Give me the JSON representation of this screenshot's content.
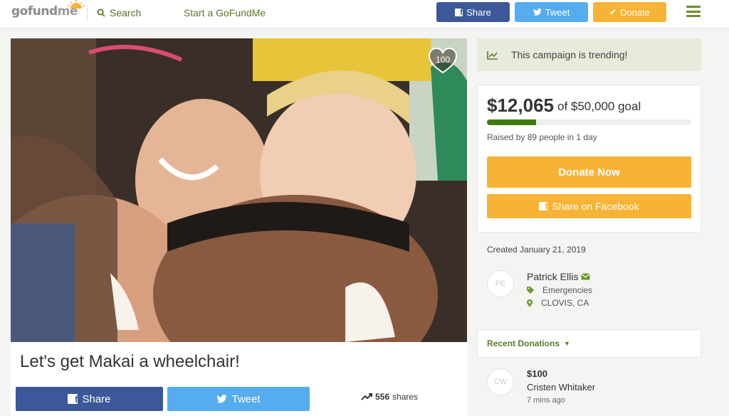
{
  "header": {
    "logo_go": "gofund",
    "logo_me": "me",
    "search_label": "Search",
    "start_label": "Start a GoFundMe",
    "share_label": "Share",
    "tweet_label": "Tweet",
    "donate_label": "Donate"
  },
  "colors": {
    "brand_green": "#5a7a2a",
    "facebook": "#3b5998",
    "twitter": "#55acee",
    "donate": "#f6b335",
    "progress": "#3f7a12"
  },
  "campaign": {
    "heart_count": "100",
    "title": "Let's get Makai a wheelchair!",
    "share_label": "Share",
    "tweet_label": "Tweet",
    "shares_count": "556",
    "shares_label": "shares"
  },
  "sidebar": {
    "trending_text": "This campaign is trending!",
    "raised_amount": "$12,065",
    "goal_text": "of $50,000 goal",
    "progress_fraction": 0.2413,
    "raised_by": "Raised by 89 people in 1 day",
    "donate_now_label": "Donate Now",
    "share_facebook_label": "Share on Facebook",
    "created": "Created January 21, 2019",
    "organizer": {
      "initials": "PE",
      "name": "Patrick Ellis",
      "category": "Emergencies",
      "location": "CLOVIS, CA"
    },
    "recent_donations_label": "Recent Donations",
    "donations": [
      {
        "initials": "CW",
        "amount": "$100",
        "name": "Cristen Whitaker",
        "time": "7 mins ago"
      }
    ]
  }
}
